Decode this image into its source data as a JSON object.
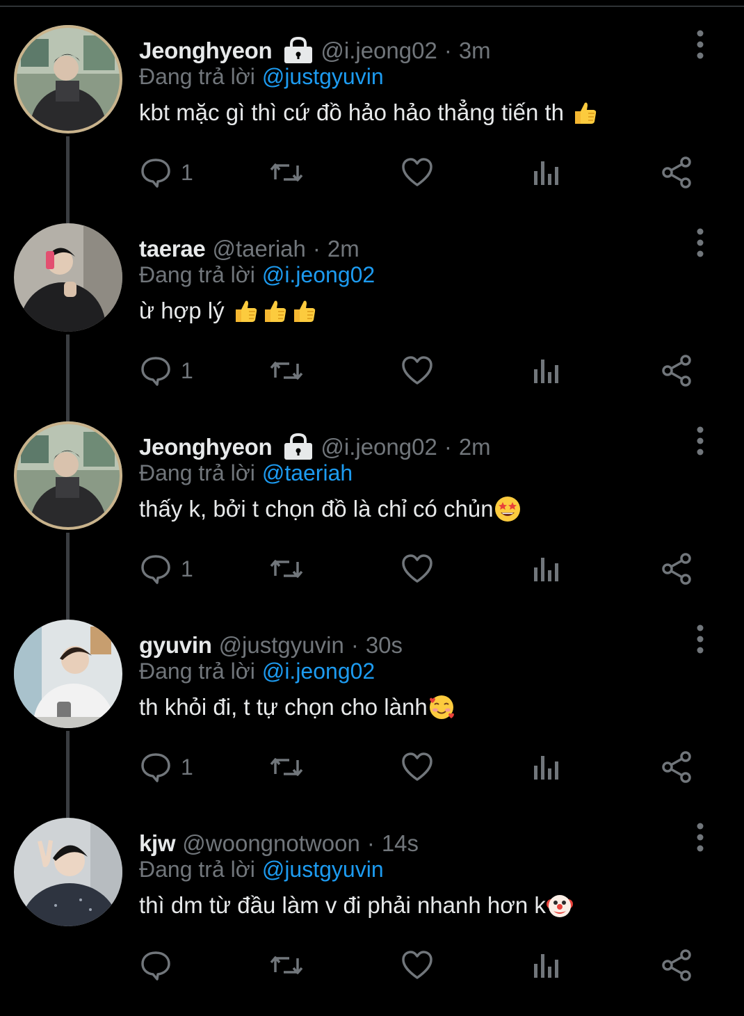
{
  "colors": {
    "background": "#000000",
    "text_primary": "#e7e9ea",
    "text_secondary": "#71767b",
    "mention": "#1d9bf0",
    "thread_line": "#3a3d41"
  },
  "tweets": [
    {
      "name": "Jeonghyeon",
      "locked": true,
      "handle": "@i.jeong02",
      "separator": "·",
      "time": "3m",
      "reply_label": "Đang trả lời",
      "reply_to": "@justgyuvin",
      "text": "kbt mặc gì thì cứ đồ hảo hảo thẳng tiến th",
      "emoji": "thumbs-up-icon",
      "reply_count": "1",
      "avatar": "avatar-mirror-selfie"
    },
    {
      "name": "taerae",
      "locked": false,
      "handle": "@taeriah",
      "separator": "·",
      "time": "2m",
      "reply_label": "Đang trả lời",
      "reply_to": "@i.jeong02",
      "text": "ừ hợp lý",
      "emoji": "thumbs-up-icon",
      "reply_count": "1",
      "avatar": "avatar-phone-selfie"
    },
    {
      "name": "Jeonghyeon",
      "locked": true,
      "handle": "@i.jeong02",
      "separator": "·",
      "time": "2m",
      "reply_label": "Đang trả lời",
      "reply_to": "@taeriah",
      "text": "thấy k, bởi t chọn đồ là chỉ có chủn",
      "emoji": "star-struck-icon",
      "reply_count": "1",
      "avatar": "avatar-mirror-selfie"
    },
    {
      "name": "gyuvin",
      "locked": false,
      "handle": "@justgyuvin",
      "separator": "·",
      "time": "30s",
      "reply_label": "Đang trả lời",
      "reply_to": "@i.jeong02",
      "text": "th khỏi đi, t tự chọn cho lành",
      "emoji": "smiling-hearts-icon",
      "reply_count": "1",
      "avatar": "avatar-cafe-photo"
    },
    {
      "name": "kjw",
      "locked": false,
      "handle": "@woongnotwoon",
      "separator": "·",
      "time": "14s",
      "reply_label": "Đang trả lời",
      "reply_to": "@justgyuvin",
      "text": "thì dm từ đầu làm v đi phải nhanh hơn k",
      "emoji": "clown-face-icon",
      "reply_count": "",
      "avatar": "avatar-peace-sign"
    }
  ]
}
